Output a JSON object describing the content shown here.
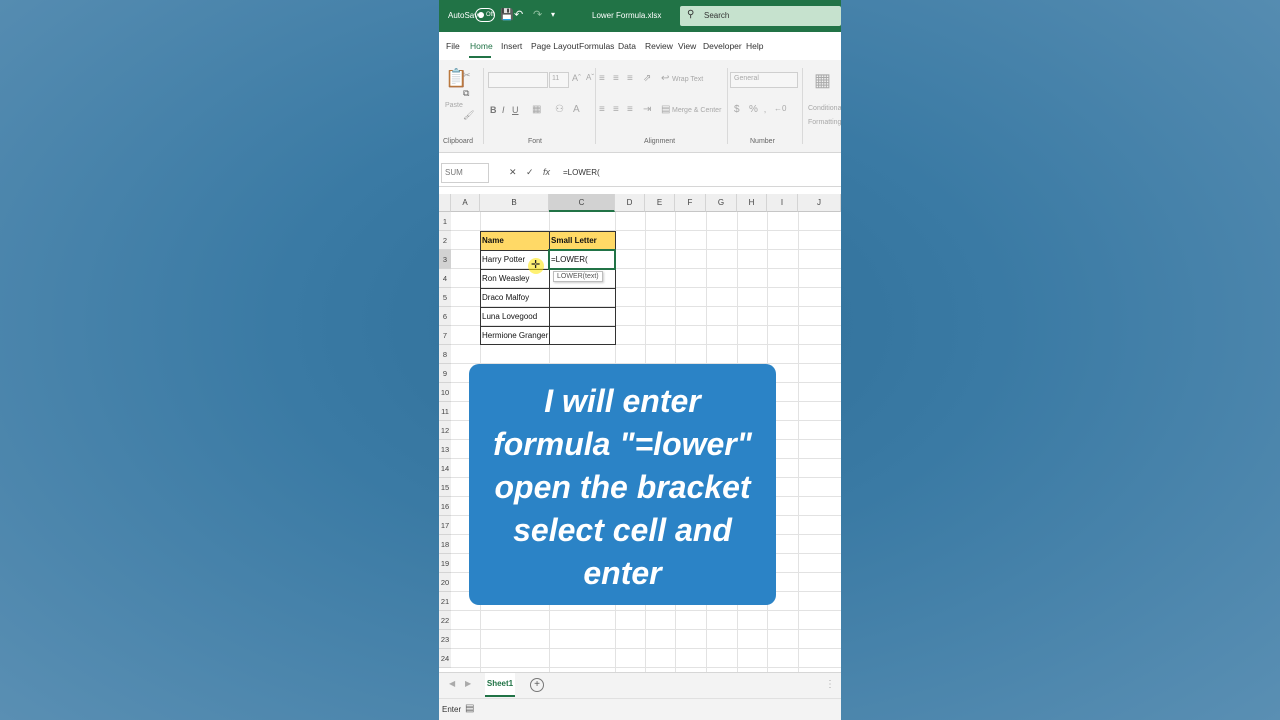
{
  "titlebar": {
    "autosave_label": "AutoSave",
    "autosave_state": "Off",
    "filename": "Lower Formula.xlsx",
    "search_label": "Search"
  },
  "menu": [
    "File",
    "Home",
    "Insert",
    "Page Layout",
    "Formulas",
    "Data",
    "Review",
    "View",
    "Developer",
    "Help"
  ],
  "ribbon": {
    "paste_label": "Paste",
    "font_size": "11",
    "wrap_text": "Wrap Text",
    "merge_center": "Merge & Center",
    "number_format": "General",
    "currency_symbol": "$",
    "percent_symbol": "%",
    "conditional_formatting": "Conditional Formatting",
    "groups": [
      "Clipboard",
      "Font",
      "Alignment",
      "Number"
    ]
  },
  "formula_bar": {
    "name_box": "SUM",
    "formula": "=LOWER("
  },
  "grid": {
    "columns": [
      "A",
      "B",
      "C",
      "D",
      "E",
      "F",
      "G",
      "H",
      "I",
      "J"
    ],
    "rows": [
      "1",
      "2",
      "3",
      "4",
      "5",
      "6",
      "7",
      "8",
      "9",
      "10",
      "11",
      "12",
      "13",
      "14",
      "15",
      "16",
      "17",
      "18",
      "19",
      "20",
      "21",
      "22",
      "23",
      "24"
    ],
    "table": {
      "headers": [
        "Name",
        "Small Letter"
      ],
      "names": [
        "Harry Potter",
        "Ron Weasley",
        "Draco Malfoy",
        "Luna Lovegood",
        "Hermione Granger"
      ],
      "active_cell_value": "=LOWER(",
      "tooltip": "LOWER(text)"
    }
  },
  "sheets": {
    "active": "Sheet1"
  },
  "status": {
    "mode": "Enter"
  },
  "caption": {
    "lines": [
      "I will enter",
      "formula \"=lower\"",
      "open the bracket",
      "select cell and",
      "enter"
    ]
  },
  "colors": {
    "excel_green": "#217346",
    "header_fill": "#ffd966",
    "caption_bg": "#2b83c6"
  }
}
